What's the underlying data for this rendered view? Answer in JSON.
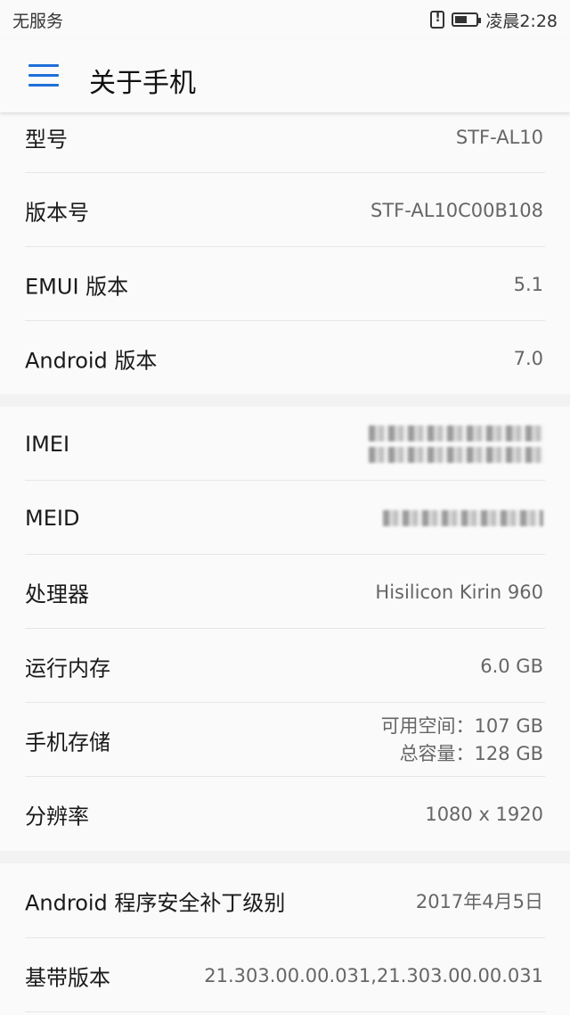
{
  "status_bar": {
    "carrier": "无服务",
    "time": "凌晨2:28"
  },
  "app_bar": {
    "title": "关于手机"
  },
  "sections": [
    {
      "rows": [
        {
          "label": "型号",
          "value": "STF-AL10"
        },
        {
          "label": "版本号",
          "value": "STF-AL10C00B108"
        },
        {
          "label": "EMUI 版本",
          "value": "5.1"
        },
        {
          "label": "Android 版本",
          "value": "7.0"
        }
      ]
    },
    {
      "rows": [
        {
          "label": "IMEI",
          "value": ""
        },
        {
          "label": "MEID",
          "value": ""
        },
        {
          "label": "处理器",
          "value": "Hisilicon Kirin 960"
        },
        {
          "label": "运行内存",
          "value": "6.0 GB"
        },
        {
          "label": "手机存储",
          "value_line1": "可用空间：107  GB",
          "value_line2": "总容量：128  GB"
        },
        {
          "label": "分辨率",
          "value": "1080 x 1920"
        }
      ]
    },
    {
      "rows": [
        {
          "label": "Android 程序安全补丁级别",
          "value": "2017年4月5日"
        },
        {
          "label": "基带版本",
          "value": "21.303.00.00.031,21.303.00.00.031"
        }
      ]
    }
  ],
  "colors": {
    "accent": "#1e6fd9",
    "background": "#f2f2f2",
    "card": "#fafafa"
  }
}
